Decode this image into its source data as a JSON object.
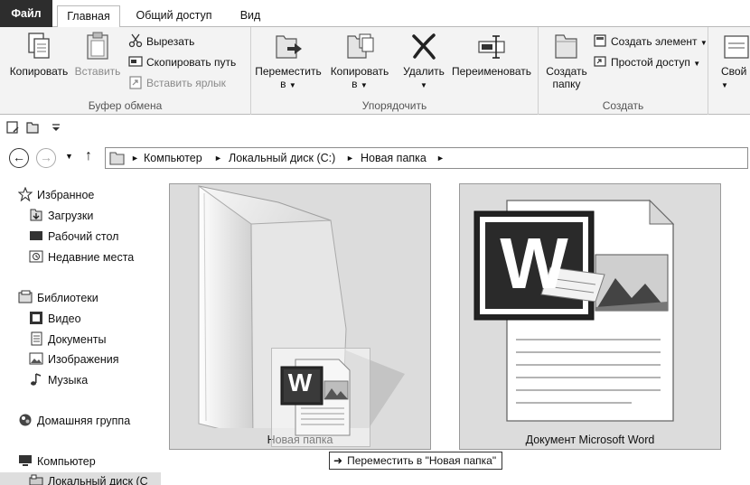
{
  "tabs": {
    "file": "Файл",
    "home": "Главная",
    "share": "Общий доступ",
    "view": "Вид"
  },
  "ribbon": {
    "clipboard": {
      "label": "Буфер обмена",
      "copy": "Копировать",
      "paste": "Вставить",
      "cut": "Вырезать",
      "copy_path": "Скопировать путь",
      "paste_shortcut": "Вставить ярлык"
    },
    "organize": {
      "label": "Упорядочить",
      "move_line1": "Переместить",
      "move_line2": "в",
      "copy_line1": "Копировать",
      "copy_line2": "в",
      "delete": "Удалить",
      "rename": "Переименовать"
    },
    "new": {
      "label": "Создать",
      "new_folder_line1": "Создать",
      "new_folder_line2": "папку",
      "new_item": "Создать элемент",
      "easy_access": "Простой доступ"
    },
    "more": {
      "properties": "Свой"
    }
  },
  "address": {
    "crumbs": [
      "Компьютер",
      "Локальный диск (C:)",
      "Новая папка"
    ]
  },
  "nav": {
    "favorites": "Избранное",
    "downloads": "Загрузки",
    "desktop": "Рабочий стол",
    "recent": "Недавние места",
    "libraries": "Библиотеки",
    "video": "Видео",
    "documents": "Документы",
    "pictures": "Изображения",
    "music": "Музыка",
    "homegroup": "Домашняя группа",
    "computer": "Компьютер",
    "local_disk": "Локальный диск (C"
  },
  "content": {
    "folder_name": "Новая папка",
    "doc_name": "Документ Microsoft Word",
    "tooltip": "Переместить в \"Новая папка\""
  },
  "icons": {
    "word_letter": "W"
  }
}
